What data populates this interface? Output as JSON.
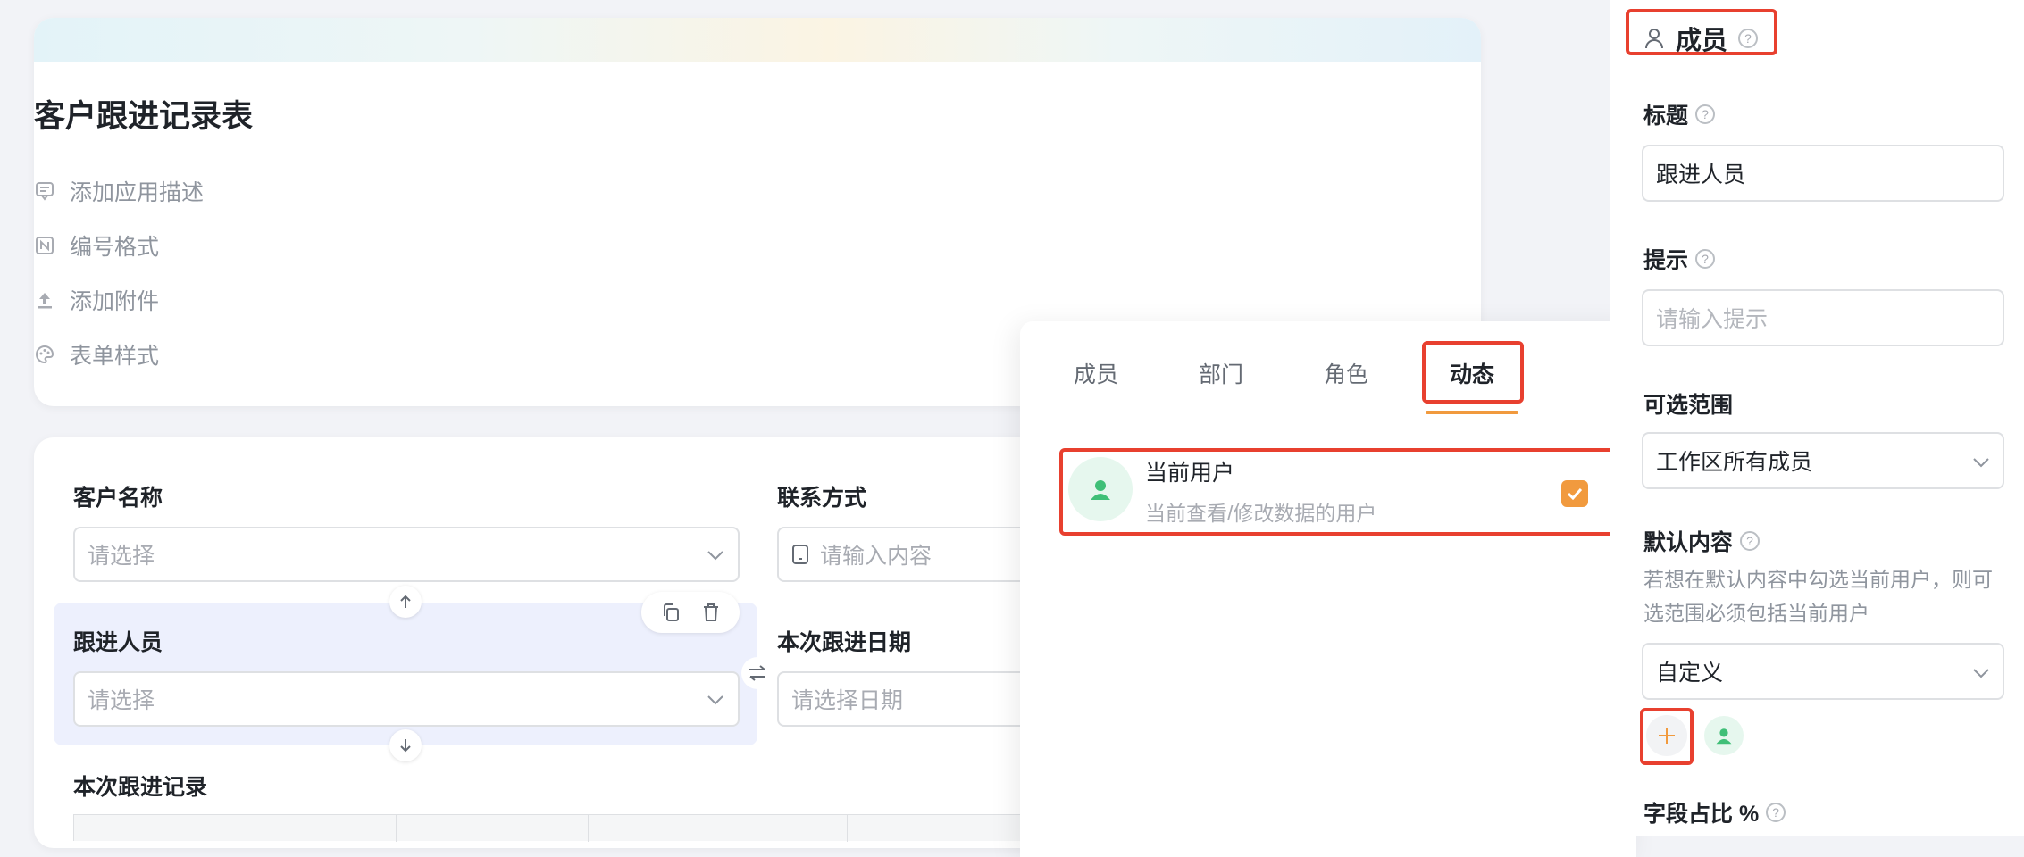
{
  "app": {
    "title": "客户跟进记录表",
    "options": [
      {
        "icon": "comment-icon",
        "label": "添加应用描述"
      },
      {
        "icon": "numbering-icon",
        "label": "编号格式"
      },
      {
        "icon": "upload-icon",
        "label": "添加附件"
      },
      {
        "icon": "palette-icon",
        "label": "表单样式"
      }
    ]
  },
  "form": {
    "customer_name": {
      "label": "客户名称",
      "placeholder": "请选择"
    },
    "contact": {
      "label": "联系方式",
      "placeholder": "请输入内容"
    },
    "follower": {
      "label": "跟进人员",
      "placeholder": "请选择"
    },
    "follow_date": {
      "label": "本次跟进日期",
      "placeholder": "请选择日期"
    },
    "follow_record": {
      "label": "本次跟进记录"
    }
  },
  "popup": {
    "tabs": [
      {
        "label": "成员",
        "active": false
      },
      {
        "label": "部门",
        "active": false
      },
      {
        "label": "角色",
        "active": false
      },
      {
        "label": "动态",
        "active": true
      }
    ],
    "option": {
      "title": "当前用户",
      "description": "当前查看/修改数据的用户",
      "checked": true
    }
  },
  "panel": {
    "header": "成员",
    "title_label": "标题",
    "title_value": "跟进人员",
    "hint_label": "提示",
    "hint_placeholder": "请输入提示",
    "range_label": "可选范围",
    "range_value": "工作区所有成员",
    "default_label": "默认内容",
    "default_note": "若想在默认内容中勾选当前用户，则可选范围必须包括当前用户",
    "default_value": "自定义",
    "ratio_label": "字段占比 %"
  },
  "colors": {
    "accent": "#f19a3e",
    "highlight_box": "#e8402f",
    "selected_field_bg": "#edf0fd",
    "avatar": "#3fbf77"
  }
}
